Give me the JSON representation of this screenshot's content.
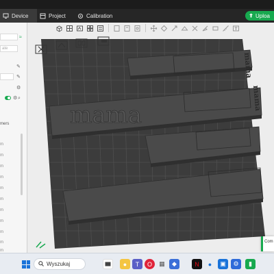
{
  "menubar": {
    "tabs": [
      {
        "label": "Device"
      },
      {
        "label": "Project"
      },
      {
        "label": "Calibration"
      }
    ],
    "upload_label": "Uploa"
  },
  "sidebar": {
    "field_placeholder": "ate",
    "section_label": "mers",
    "units": [
      "m",
      "m",
      "m",
      "m",
      "m",
      "m",
      "m",
      "m",
      "m",
      "m",
      "m",
      "m"
    ]
  },
  "scene": {
    "embossed_text": "mama",
    "tile_texts": [
      "mama",
      "mama"
    ],
    "plate_color": "#3c3c3c",
    "part_color": "#4a4a4a"
  },
  "toast": {
    "text": "Com"
  },
  "taskbar": {
    "search_placeholder": "Wyszukaj",
    "apps": [
      "file-explorer",
      "chrome",
      "teams",
      "opera",
      "store",
      "netflix",
      "edge",
      "photos",
      "settings",
      "bambu-studio"
    ]
  },
  "colors": {
    "accent": "#17a94f",
    "menubar": "#262626",
    "viewport": "#ededed"
  }
}
